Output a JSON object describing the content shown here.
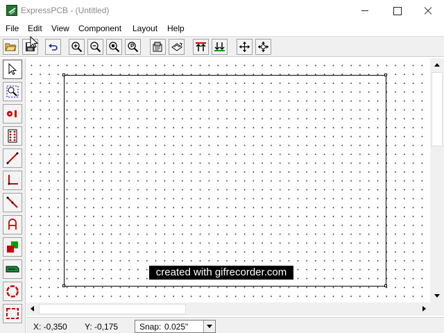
{
  "window": {
    "title": "ExpressPCB - (Untitled)",
    "icon": "expresspcb-app-icon"
  },
  "menu": [
    {
      "label": "File"
    },
    {
      "label": "Edit"
    },
    {
      "label": "View"
    },
    {
      "label": "Component"
    },
    {
      "label": "Layout"
    },
    {
      "label": "Help"
    }
  ],
  "toolbar": {
    "icons": [
      "open-folder-icon",
      "save-icon",
      "undo-icon",
      "zoom-in-icon",
      "zoom-out-icon",
      "zoom-fit-icon",
      "zoom-previous-icon",
      "properties-icon",
      "print-icon",
      "place-top-icon",
      "place-bottom-icon",
      "move-icon",
      "auto-route-icon"
    ]
  },
  "palette": {
    "icons": [
      "select-arrow-icon",
      "zoom-region-icon",
      "pad-icon",
      "component-icon",
      "trace-icon",
      "corner-trace-icon",
      "diagonal-trace-icon",
      "text-icon",
      "fill-plane-icon",
      "edge-connector-icon",
      "circle-icon",
      "rectangle-icon"
    ]
  },
  "canvas": {
    "watermark": "created with gifrecorder.com"
  },
  "status": {
    "x": "X: -0,350",
    "y": "Y: -0,175",
    "snap_label": "Snap:",
    "snap_value": "0.025\""
  },
  "colors": {
    "app_green": "#1a7a2a",
    "pcb_red": "#cc0000",
    "pcb_green": "#00a000"
  }
}
